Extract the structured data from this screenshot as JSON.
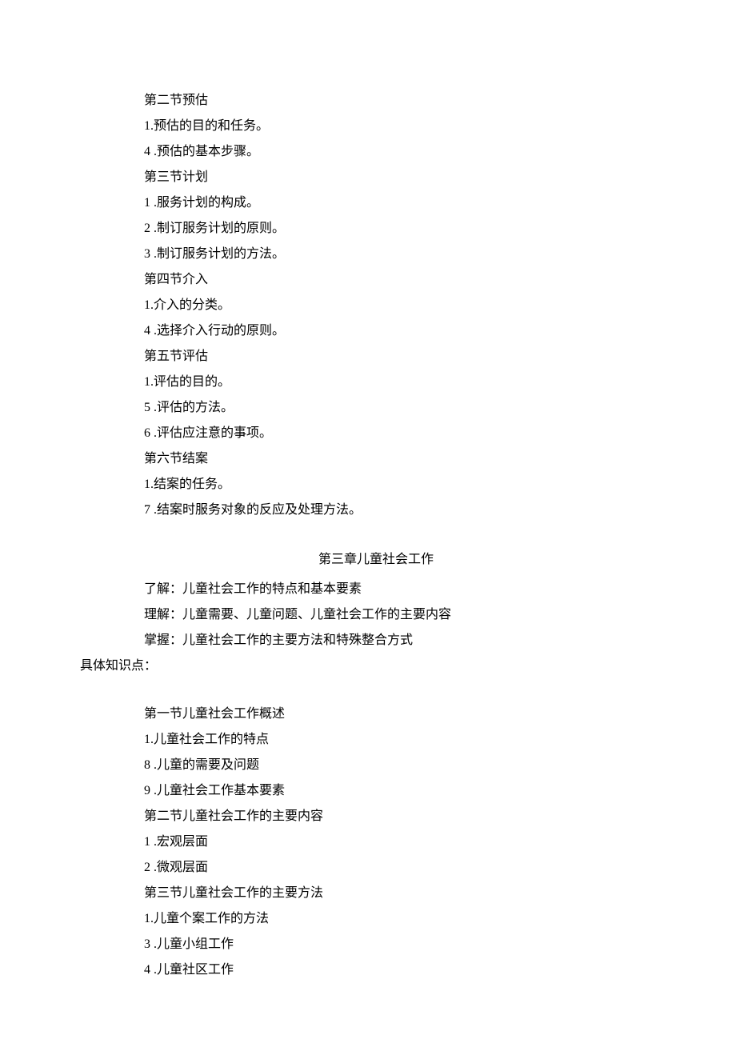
{
  "section2": {
    "title": "第二节预估",
    "items": [
      "1.预估的目的和任务。",
      "4 .预估的基本步骤。"
    ]
  },
  "section3": {
    "title": "第三节计划",
    "items": [
      "1 .服务计划的构成。",
      "2 .制订服务计划的原则。",
      "3 .制订服务计划的方法。"
    ]
  },
  "section4": {
    "title": "第四节介入",
    "items": [
      "1.介入的分类。",
      "4 .选择介入行动的原则。"
    ]
  },
  "section5": {
    "title": "第五节评估",
    "items": [
      "1.评估的目的。",
      "5 .评估的方法。",
      "6 .评估应注意的事项。"
    ]
  },
  "section6": {
    "title": "第六节结案",
    "items": [
      "1.结案的任务。",
      "7 .结案时服务对象的反应及处理方法。"
    ]
  },
  "chapter3": {
    "title": "第三章儿童社会工作",
    "intro": [
      "了解：儿童社会工作的特点和基本要素",
      "理解：儿童需要、儿童问题、儿童社会工作的主要内容",
      "掌握：儿童社会工作的主要方法和特殊整合方式"
    ],
    "knowledgeLabel": "具体知识点：",
    "sub1": {
      "title": "第一节儿童社会工作概述",
      "items": [
        "1.儿童社会工作的特点",
        "8 .儿童的需要及问题",
        "9 .儿童社会工作基本要素"
      ]
    },
    "sub2": {
      "title": "第二节儿童社会工作的主要内容",
      "items": [
        "1 .宏观层面",
        "2 .微观层面"
      ]
    },
    "sub3": {
      "title": "第三节儿童社会工作的主要方法",
      "items": [
        "1.儿童个案工作的方法",
        "3 .儿童小组工作",
        "4 .儿童社区工作"
      ]
    }
  }
}
